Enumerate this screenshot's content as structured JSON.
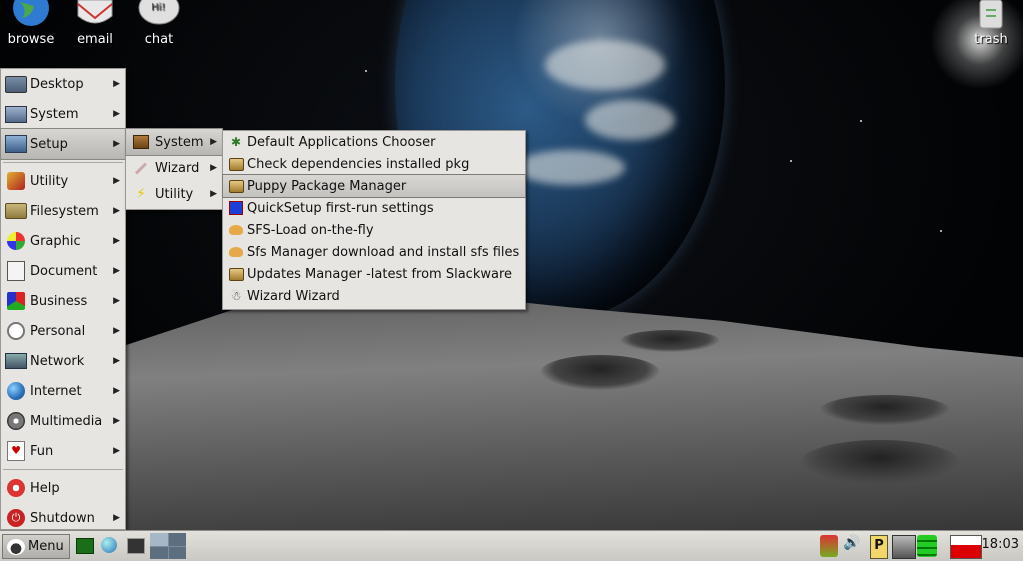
{
  "desktop_icons": [
    {
      "label": "browse",
      "icon": "globe-icon"
    },
    {
      "label": "email",
      "icon": "email-icon"
    },
    {
      "label": "chat",
      "icon": "chat-bubble-icon"
    },
    {
      "label": "trash",
      "icon": "trash-icon"
    }
  ],
  "chat_bubble_text": "Hi!",
  "main_menu": {
    "items": [
      {
        "label": "Desktop",
        "icon": "desktop-icon"
      },
      {
        "label": "System",
        "icon": "system-icon"
      },
      {
        "label": "Setup",
        "icon": "setup-icon"
      },
      {
        "label": "Utility",
        "icon": "utility-icon"
      },
      {
        "label": "Filesystem",
        "icon": "folder-icon"
      },
      {
        "label": "Graphic",
        "icon": "graphic-icon"
      },
      {
        "label": "Document",
        "icon": "document-icon"
      },
      {
        "label": "Business",
        "icon": "business-icon"
      },
      {
        "label": "Personal",
        "icon": "clock-icon"
      },
      {
        "label": "Network",
        "icon": "network-icon"
      },
      {
        "label": "Internet",
        "icon": "globe-icon"
      },
      {
        "label": "Multimedia",
        "icon": "multimedia-icon"
      },
      {
        "label": "Fun",
        "icon": "cards-icon"
      },
      {
        "label": "Help",
        "icon": "help-icon"
      },
      {
        "label": "Shutdown",
        "icon": "power-icon"
      }
    ],
    "active": "Setup"
  },
  "setup_submenu": {
    "items": [
      {
        "label": "System",
        "icon": "box-icon"
      },
      {
        "label": "Wizard",
        "icon": "wand-icon"
      },
      {
        "label": "Utility",
        "icon": "lightning-icon"
      }
    ],
    "active": "System"
  },
  "system_submenu": {
    "items": [
      {
        "label": "Default Applications Chooser",
        "icon": "star-icon"
      },
      {
        "label": "Check dependencies installed pkg",
        "icon": "package-icon"
      },
      {
        "label": "Puppy Package Manager",
        "icon": "package-icon"
      },
      {
        "label": "QuickSetup first-run settings",
        "icon": "quicksetup-icon"
      },
      {
        "label": "SFS-Load on-the-fly",
        "icon": "sfs-icon"
      },
      {
        "label": "Sfs Manager download and install sfs files",
        "icon": "sfs-icon"
      },
      {
        "label": "Updates Manager -latest from Slackware",
        "icon": "package-icon"
      },
      {
        "label": "Wizard Wizard",
        "icon": "wizard-icon"
      }
    ],
    "highlighted": "Puppy Package Manager"
  },
  "taskbar": {
    "menu_label": "Menu",
    "clock": "18:03",
    "tray_badge": "P"
  }
}
